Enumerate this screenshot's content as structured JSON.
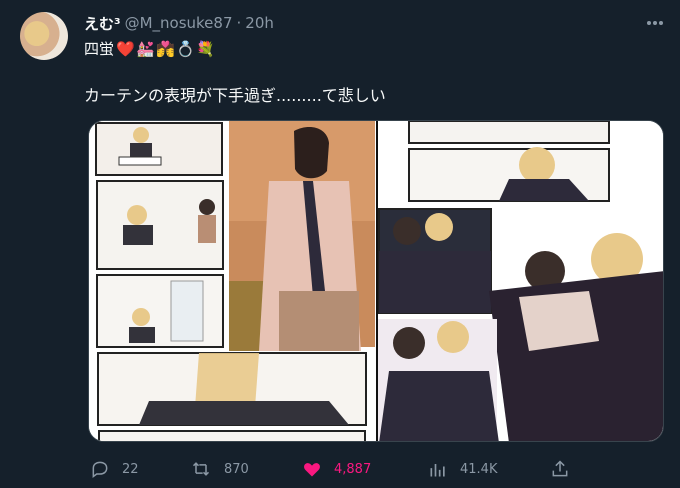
{
  "author": {
    "display_name": "えむ³",
    "handle": "@M_nosuke87",
    "separator": "·",
    "time": "20h",
    "bio_text": "四蛍",
    "bio_emojis": [
      "❤️",
      "💒",
      "💏",
      "💍",
      "💐"
    ]
  },
  "tweet": {
    "text": "カーテンの表現が下手過ぎ.........て悲しい"
  },
  "media": {
    "type": "comic-image",
    "description_icons": [
      "curtain"
    ]
  },
  "actions": {
    "reply_count": "22",
    "retweet_count": "870",
    "like_count": "4,887",
    "view_count": "41.4K"
  },
  "colors": {
    "background": "#15202b",
    "secondary_text": "#8b98a5",
    "like": "#f91880"
  }
}
